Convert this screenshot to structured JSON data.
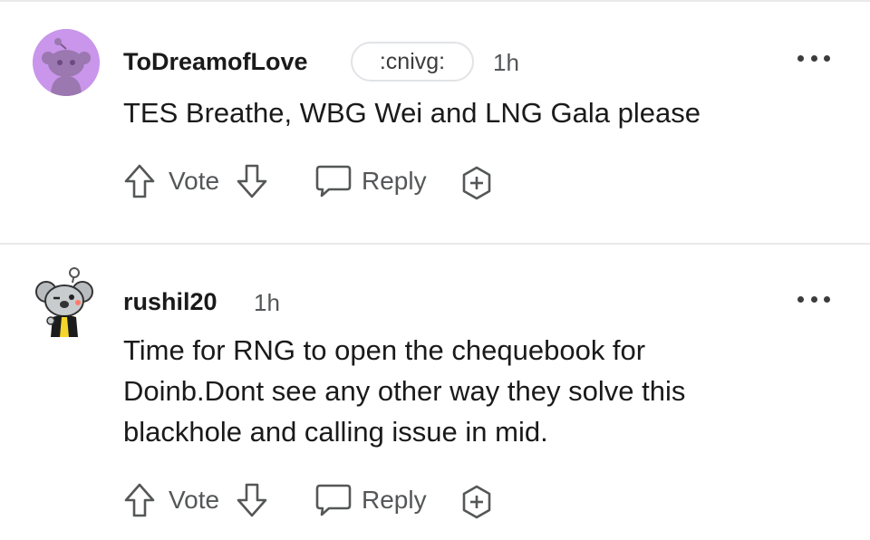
{
  "comments": [
    {
      "username": "ToDreamofLove",
      "flair": ":cnivg:",
      "time": "1h",
      "text": "TES Breathe, WBG Wei and LNG Gala please",
      "vote_label": "Vote",
      "reply_label": "Reply",
      "avatar_bg": "#c996eb"
    },
    {
      "username": "rushil20",
      "time": "1h",
      "text": "Time for RNG to open the chequebook for\nDoinb.Dont see any other way they solve this\nblackhole and calling issue in mid.",
      "vote_label": "Vote",
      "reply_label": "Reply",
      "avatar_bg": "#ffffff"
    }
  ],
  "icons": {
    "upvote": "arrow-up-outline",
    "downvote": "arrow-down-outline",
    "reply": "speech-bubble-outline",
    "award": "plus-circle-outline",
    "more": "three-dots-horizontal"
  },
  "colors": {
    "text_primary": "#1a1a1b",
    "text_secondary": "#545657",
    "divider": "#e9e9eb"
  }
}
